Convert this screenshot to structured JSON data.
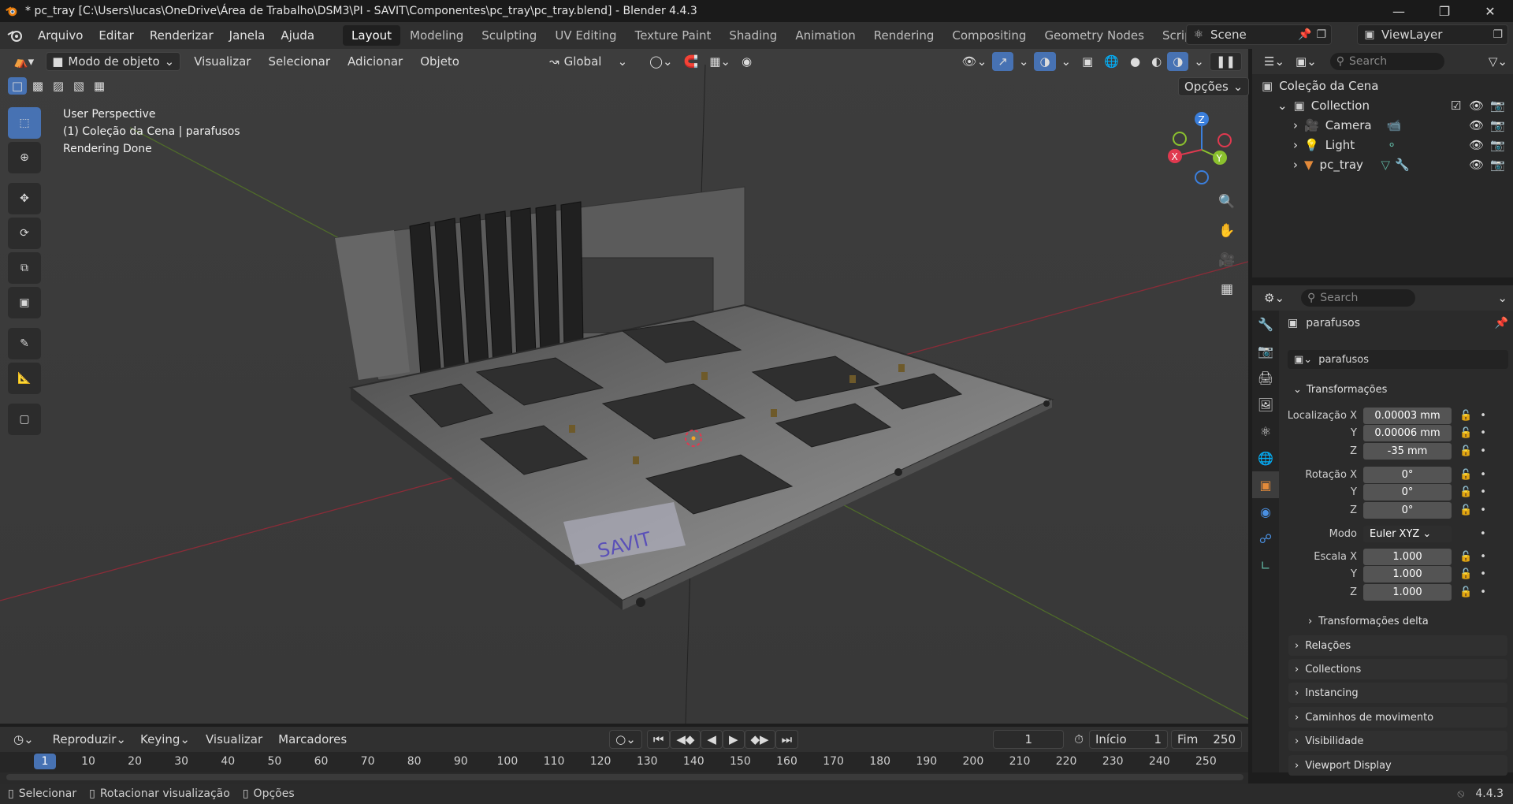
{
  "titlebar": {
    "title": "* pc_tray [C:\\Users\\lucas\\OneDrive\\Área de Trabalho\\DSM3\\PI - SAVIT\\Componentes\\pc_tray\\pc_tray.blend] - Blender 4.4.3"
  },
  "menu": [
    "Arquivo",
    "Editar",
    "Renderizar",
    "Janela",
    "Ajuda"
  ],
  "workspaces": [
    "Layout",
    "Modeling",
    "Sculpting",
    "UV Editing",
    "Texture Paint",
    "Shading",
    "Animation",
    "Rendering",
    "Compositing",
    "Geometry Nodes",
    "Scripting"
  ],
  "scene_name": "Scene",
  "view_layer": "ViewLayer",
  "viewport_header": {
    "mode": "Modo de objeto",
    "menus": [
      "Visualizar",
      "Selecionar",
      "Adicionar",
      "Objeto"
    ],
    "orientation": "Global",
    "options": "Opções"
  },
  "viewport_overlay": {
    "line1": "User Perspective",
    "line2": "(1) Coleção da Cena | parafusos",
    "line3": "Rendering Done"
  },
  "brand_logo_text": "SAVIT",
  "gizmo": {
    "x": "X",
    "y": "Y",
    "z": "Z"
  },
  "outliner": {
    "search_placeholder": "Search",
    "root": "Coleção da Cena",
    "collection": "Collection",
    "items": [
      {
        "label": "Camera",
        "icon": "camera-icon"
      },
      {
        "label": "Light",
        "icon": "light-icon"
      },
      {
        "label": "pc_tray",
        "icon": "mesh-icon"
      }
    ]
  },
  "properties": {
    "search_placeholder": "Search",
    "object_title": "parafusos",
    "object_name": "parafusos",
    "transform_header": "Transformações",
    "location_label": "Localização X",
    "location": [
      "0.00003 mm",
      "0.00006 mm",
      "-35 mm"
    ],
    "rotation_label": "Rotação X",
    "rotation": [
      "0°",
      "0°",
      "0°"
    ],
    "mode_label": "Modo",
    "mode_value": "Euler XYZ",
    "scale_label": "Escala X",
    "scale": [
      "1.000",
      "1.000",
      "1.000"
    ],
    "axis_y": "Y",
    "axis_z": "Z",
    "delta": "Transformações delta",
    "panels": [
      "Relações",
      "Collections",
      "Instancing",
      "Caminhos de movimento",
      "Visibilidade",
      "Viewport Display"
    ]
  },
  "timeline": {
    "menus": [
      "Reproduzir",
      "Keying",
      "Visualizar",
      "Marcadores"
    ],
    "current_frame": "1",
    "start_label": "Início",
    "start": "1",
    "end_label": "Fim",
    "end": "250",
    "ruler_current": "1",
    "ruler_ticks": [
      "10",
      "20",
      "30",
      "40",
      "50",
      "60",
      "70",
      "80",
      "90",
      "100",
      "110",
      "120",
      "130",
      "140",
      "150",
      "160",
      "170",
      "180",
      "190",
      "200",
      "210",
      "220",
      "230",
      "240",
      "250"
    ]
  },
  "statusbar": {
    "items": [
      "Selecionar",
      "Rotacionar visualização",
      "Opções"
    ],
    "version": "4.4.3"
  },
  "colors": {
    "accent": "#4772b3",
    "x_axis": "#e0394f",
    "y_axis": "#8bc12e",
    "z_axis": "#3b7fdc"
  }
}
